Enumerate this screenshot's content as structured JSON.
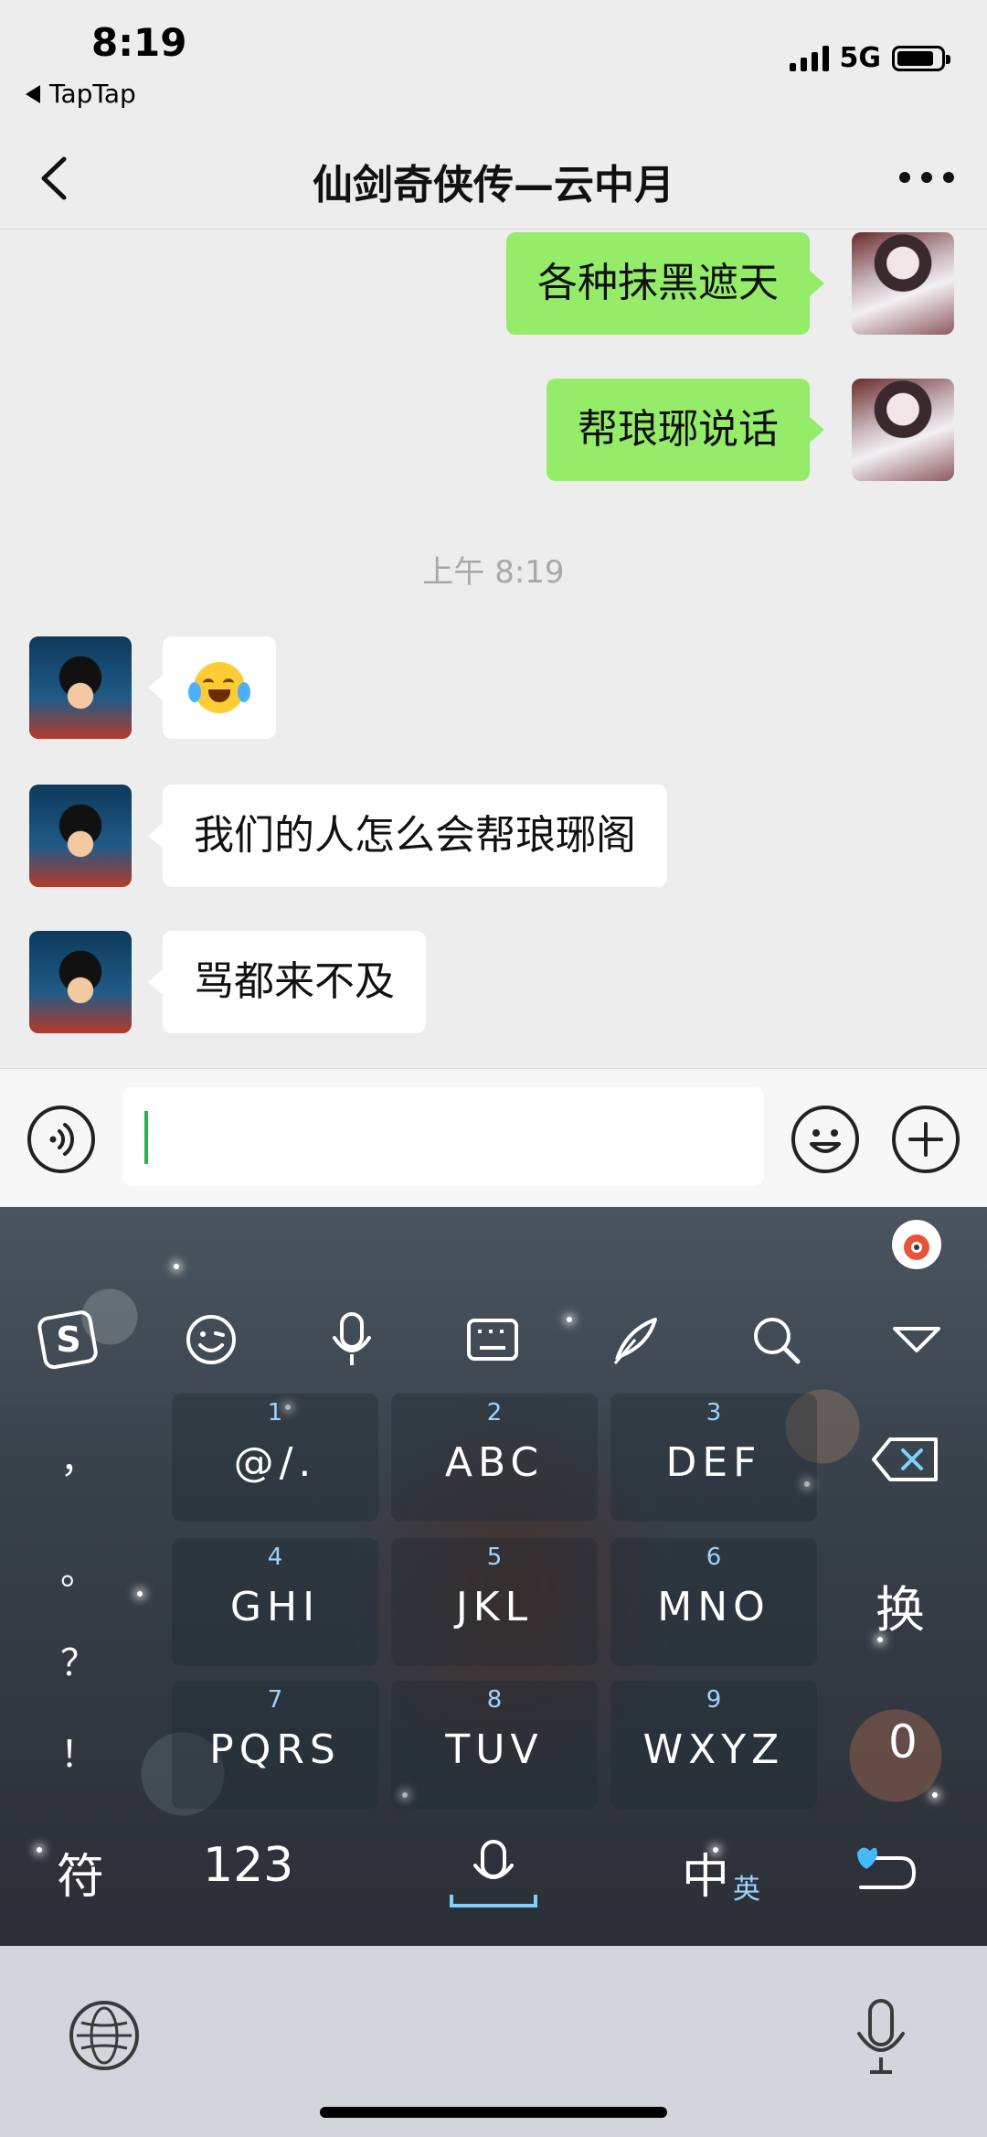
{
  "status_bar": {
    "time": "8:19",
    "back_app": "TapTap",
    "network": "5G",
    "icons": [
      "signal-icon",
      "battery-icon"
    ]
  },
  "nav": {
    "title": "仙剑奇侠传—云中月",
    "icons": [
      "back-chevron-icon",
      "more-dots-icon"
    ]
  },
  "messages": [
    {
      "direction": "outgoing",
      "text": "各种抹黑遮天"
    },
    {
      "direction": "outgoing",
      "text": "帮琅琊说话"
    },
    {
      "direction": "incoming",
      "type": "emoji",
      "emoji": "crying-laughing-face"
    },
    {
      "direction": "incoming",
      "text": "我们的人怎么会帮琅琊阁"
    },
    {
      "direction": "incoming",
      "text": "骂都来不及"
    }
  ],
  "timestamp": "上午 8:19",
  "input_bar": {
    "value": "",
    "icons": [
      "voice-icon",
      "emoji-icon",
      "plus-icon"
    ]
  },
  "keyboard": {
    "toolbar_icons": [
      "sogou-logo-icon",
      "emoji-wink-icon",
      "microphone-icon",
      "keyboard-icon",
      "quill-icon",
      "search-icon",
      "collapse-triangle-icon"
    ],
    "side_left": [
      "，",
      "。",
      "？",
      "！"
    ],
    "keys": [
      {
        "num": "1",
        "label": "@/."
      },
      {
        "num": "2",
        "label": "ABC"
      },
      {
        "num": "3",
        "label": "DEF"
      },
      {
        "num": "4",
        "label": "GHI"
      },
      {
        "num": "5",
        "label": "JKL"
      },
      {
        "num": "6",
        "label": "MNO"
      },
      {
        "num": "7",
        "label": "PQRS"
      },
      {
        "num": "8",
        "label": "TUV"
      },
      {
        "num": "9",
        "label": "WXYZ"
      }
    ],
    "right_keys": {
      "switch": "换",
      "zero": "0"
    },
    "bottom": {
      "symbols": "符",
      "numbers": "123",
      "chinese": "中",
      "english_sub": "英"
    }
  },
  "system_bar": {
    "icons": [
      "globe-icon",
      "mic-icon"
    ]
  }
}
